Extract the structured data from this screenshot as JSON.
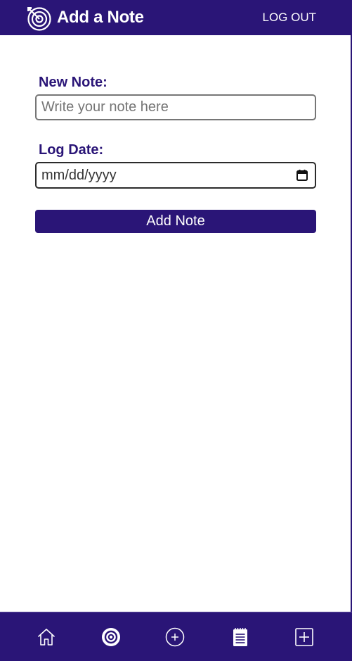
{
  "header": {
    "title": "Add a Note",
    "logout_label": "LOG OUT",
    "logo_icon": "target-arrow-icon"
  },
  "form": {
    "note_label": "New Note:",
    "note_placeholder": "Write your note here",
    "note_value": "",
    "date_label": "Log Date:",
    "date_placeholder": "mm/dd/yyyy",
    "date_icon": "calendar-icon",
    "submit_label": "Add Note"
  },
  "nav": {
    "items": [
      {
        "icon": "home-icon"
      },
      {
        "icon": "target-icon"
      },
      {
        "icon": "add-circle-icon"
      },
      {
        "icon": "notepad-icon"
      },
      {
        "icon": "add-square-icon"
      }
    ]
  },
  "colors": {
    "brand": "#2a1577",
    "white": "#ffffff",
    "input_border": "#767676"
  }
}
